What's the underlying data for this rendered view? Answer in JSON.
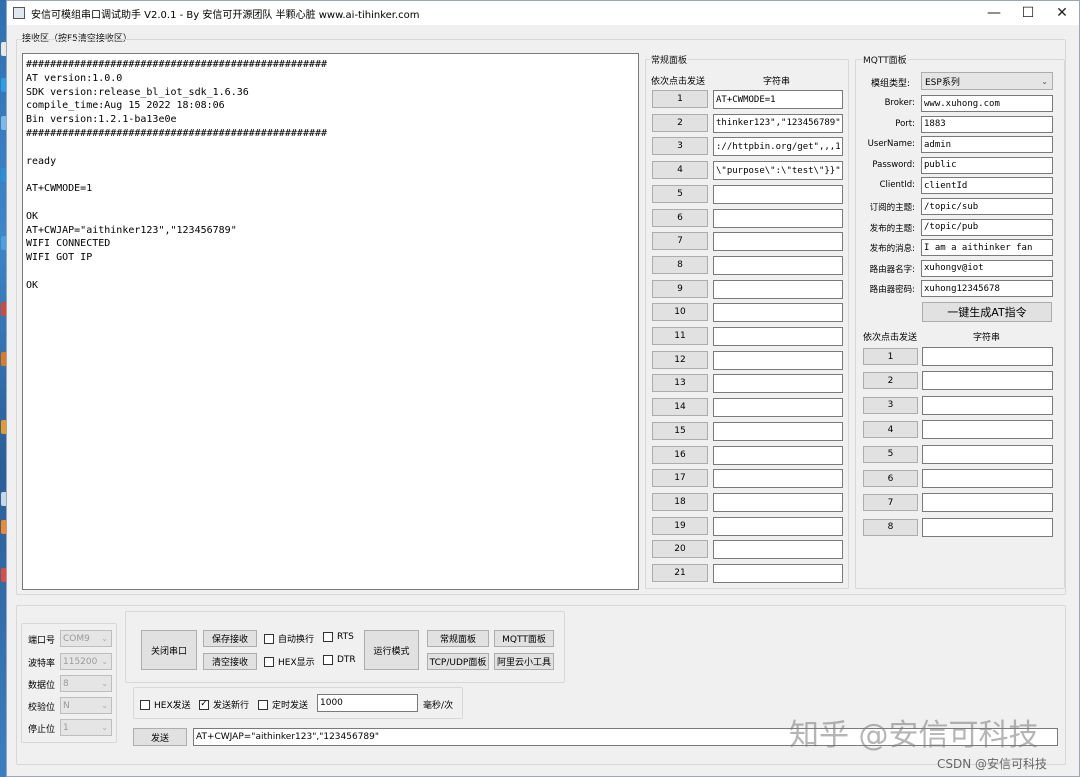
{
  "window": {
    "title": "安信可模组串口调试助手 V2.0.1 - By 安信可开源团队 半颗心脏 www.ai-tihinker.com"
  },
  "receive": {
    "group_label": "接收区（按F5清空接收区）",
    "text": "##################################################\nAT version:1.0.0\nSDK version:release_bl_iot_sdk_1.6.36\ncompile_time:Aug 15 2022 18:08:06\nBin version:1.2.1-ba13e0e\n##################################################\n\nready\n\nAT+CWMODE=1\n\nOK\nAT+CWJAP=\"aithinker123\",\"123456789\"\nWIFI CONNECTED\nWIFI GOT IP\n\nOK"
  },
  "regular_panel": {
    "title": "常规面板",
    "col_send": "依次点击发送",
    "col_string": "字符串",
    "rows": [
      {
        "label": "1",
        "value": "AT+CWMODE=1"
      },
      {
        "label": "2",
        "value": "thinker123\",\"123456789\""
      },
      {
        "label": "3",
        "value": "://httpbin.org/get\",,,1"
      },
      {
        "label": "4",
        "value": "\\\"purpose\\\":\\\"test\\\"}}\""
      },
      {
        "label": "5",
        "value": ""
      },
      {
        "label": "6",
        "value": ""
      },
      {
        "label": "7",
        "value": ""
      },
      {
        "label": "8",
        "value": ""
      },
      {
        "label": "9",
        "value": ""
      },
      {
        "label": "10",
        "value": ""
      },
      {
        "label": "11",
        "value": ""
      },
      {
        "label": "12",
        "value": ""
      },
      {
        "label": "13",
        "value": ""
      },
      {
        "label": "14",
        "value": ""
      },
      {
        "label": "15",
        "value": ""
      },
      {
        "label": "16",
        "value": ""
      },
      {
        "label": "17",
        "value": ""
      },
      {
        "label": "18",
        "value": ""
      },
      {
        "label": "19",
        "value": ""
      },
      {
        "label": "20",
        "value": ""
      },
      {
        "label": "21",
        "value": ""
      }
    ]
  },
  "mqtt_panel": {
    "title": "MQTT面板",
    "type_label": "模组类型:",
    "type_value": "ESP系列",
    "fields": [
      {
        "label": "Broker:",
        "value": "www.xuhong.com"
      },
      {
        "label": "Port:",
        "value": "1883"
      },
      {
        "label": "UserName:",
        "value": "admin"
      },
      {
        "label": "Password:",
        "value": "public"
      },
      {
        "label": "ClientId:",
        "value": "clientId"
      },
      {
        "label": "订阅的主题:",
        "value": "/topic/sub"
      },
      {
        "label": "发布的主题:",
        "value": "/topic/pub"
      },
      {
        "label": "发布的消息:",
        "value": "I am a aithinker fan"
      },
      {
        "label": "路由器名字:",
        "value": "xuhongv@iot"
      },
      {
        "label": "路由器密码:",
        "value": "xuhong12345678"
      }
    ],
    "generate_button": "一键生成AT指令",
    "col_send": "依次点击发送",
    "col_string": "字符串",
    "rows": [
      {
        "label": "1",
        "value": ""
      },
      {
        "label": "2",
        "value": ""
      },
      {
        "label": "3",
        "value": ""
      },
      {
        "label": "4",
        "value": ""
      },
      {
        "label": "5",
        "value": ""
      },
      {
        "label": "6",
        "value": ""
      },
      {
        "label": "7",
        "value": ""
      },
      {
        "label": "8",
        "value": ""
      }
    ]
  },
  "serial": {
    "port_label": "端口号",
    "port_value": "COM9",
    "baud_label": "波特率",
    "baud_value": "115200",
    "databits_label": "数据位",
    "databits_value": "8",
    "parity_label": "校验位",
    "parity_value": "N",
    "stopbits_label": "停止位",
    "stopbits_value": "1"
  },
  "controls": {
    "close_port": "关闭串口",
    "save_receive": "保存接收",
    "clear_receive": "清空接收",
    "auto_newline": "自动换行",
    "hex_display": "HEX显示",
    "rts": "RTS",
    "dtr": "DTR",
    "run_mode": "运行模式",
    "regular_panel_btn": "常规面板",
    "mqtt_panel_btn": "MQTT面板",
    "tcp_udp_btn": "TCP/UDP面板",
    "aliyun_btn": "阿里云小工具",
    "hex_send": "HEX发送",
    "send_newline": "发送新行",
    "timed_send": "定时发送",
    "interval_value": "1000",
    "interval_unit": "毫秒/次",
    "send_button": "发送",
    "send_value": "AT+CWJAP=\"aithinker123\",\"123456789\""
  },
  "overlay": {
    "watermark": "知乎 @安信可科技",
    "csdn": "CSDN @安信可科技"
  }
}
